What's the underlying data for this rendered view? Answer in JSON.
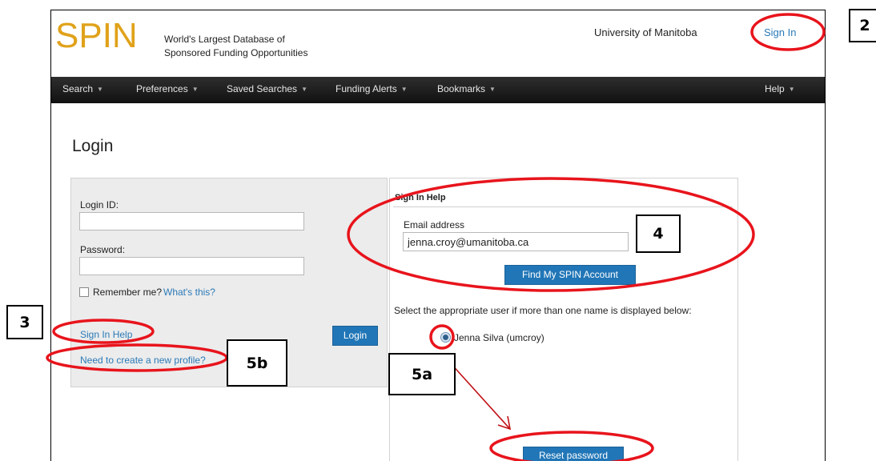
{
  "header": {
    "logo": "SPIN",
    "tagline_line1": "World's Largest Database of",
    "tagline_line2": "Sponsored Funding Opportunities",
    "institution": "University of Manitoba",
    "sign_in": "Sign In"
  },
  "nav": {
    "items": [
      {
        "label": "Search"
      },
      {
        "label": "Preferences"
      },
      {
        "label": "Saved Searches"
      },
      {
        "label": "Funding Alerts"
      },
      {
        "label": "Bookmarks"
      }
    ],
    "help": "Help"
  },
  "page": {
    "title": "Login"
  },
  "login_form": {
    "login_id_label": "Login ID:",
    "login_id_value": "",
    "password_label": "Password:",
    "password_value": "",
    "remember_label": "Remember me?",
    "whats_this": "What's this?",
    "sign_in_help": "Sign In Help",
    "login_button": "Login",
    "create_profile": "Need to create a new profile?"
  },
  "sign_in_help": {
    "title": "Sign In Help",
    "email_label": "Email address",
    "email_value": "jenna.croy@umanitoba.ca",
    "find_button": "Find My SPIN Account",
    "select_text": "Select the appropriate user if more than one name is displayed below:",
    "user_option": "Jenna Silva (umcroy)",
    "reset_button": "Reset password"
  },
  "annotations": {
    "step2": "2",
    "step3": "3",
    "step4": "4",
    "step5a": "5a",
    "step5b": "5b",
    "highlight_color": "#e8141c"
  }
}
